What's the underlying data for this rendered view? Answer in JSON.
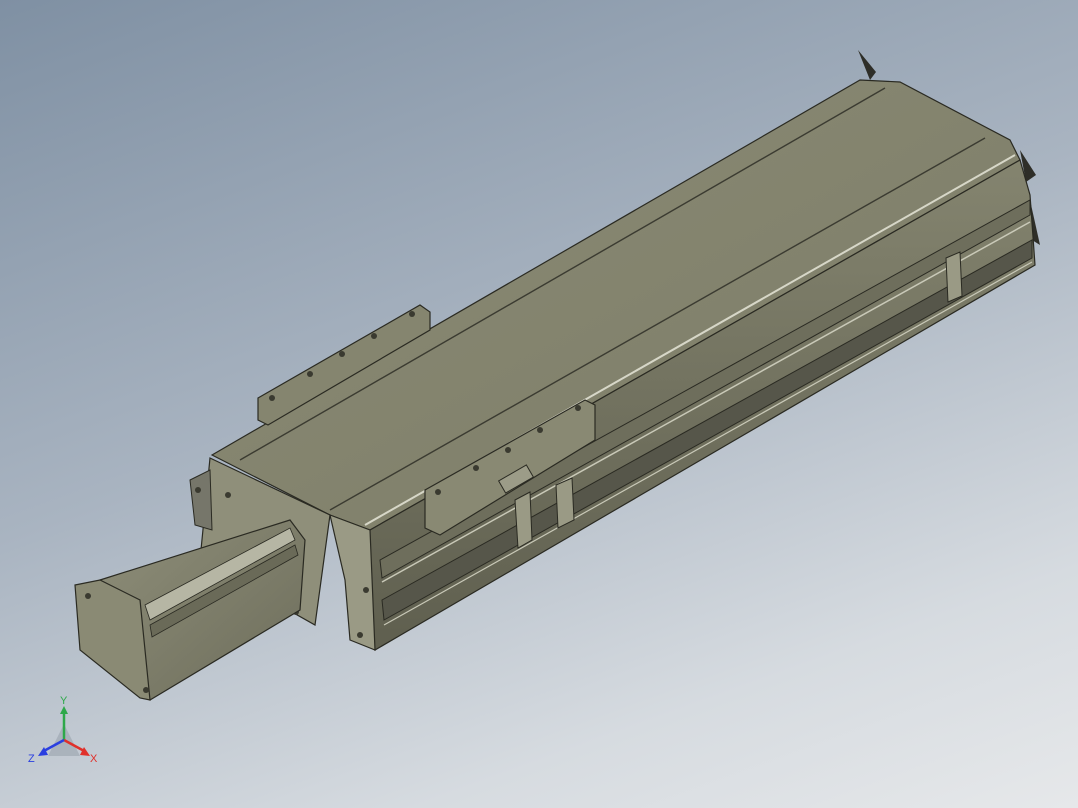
{
  "viewport": {
    "background_top": "#7f90a3",
    "background_bottom": "#e6e8ea"
  },
  "model": {
    "body_color": "#8a8a74",
    "top_color": "#7e7e69",
    "edge_color": "#2a2a22",
    "highlight_color": "#d7d7c8"
  },
  "triad": {
    "x_label": "X",
    "y_label": "Y",
    "z_label": "Z",
    "x_color": "#e0302a",
    "y_color": "#2ea84a",
    "z_color": "#2a3fe0"
  }
}
